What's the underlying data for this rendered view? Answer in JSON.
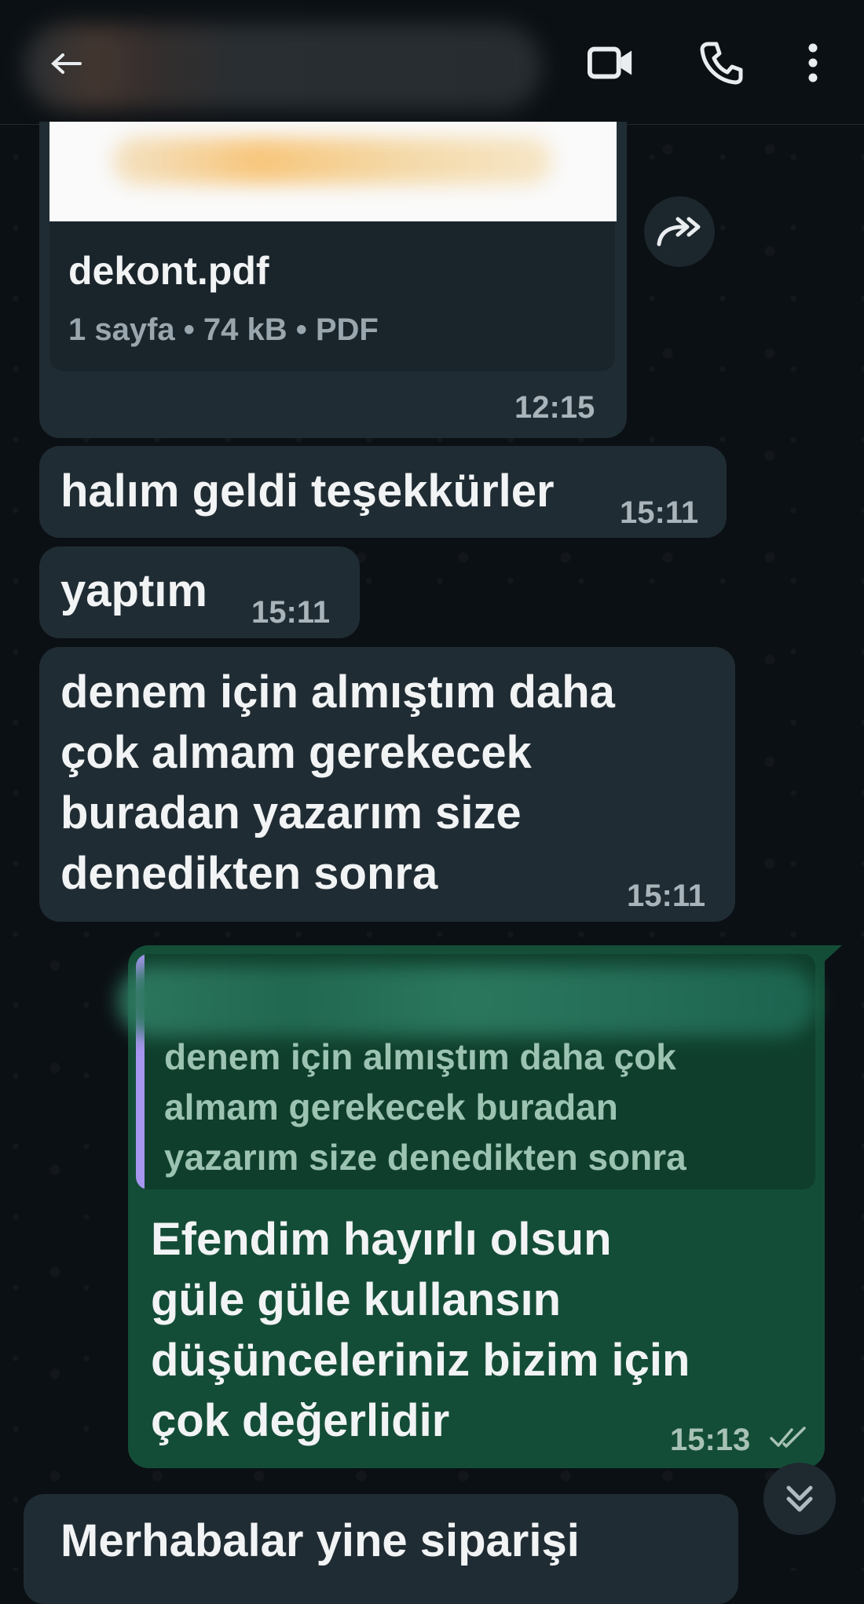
{
  "header": {
    "back_icon": "back-arrow-icon",
    "video_icon": "video-camera-icon",
    "call_icon": "phone-icon",
    "menu_icon": "more-vertical-icon"
  },
  "messages": [
    {
      "direction": "incoming",
      "type": "document",
      "file_name": "dekont.pdf",
      "file_meta": "1 sayfa • 74 kB • PDF",
      "time": "12:15"
    },
    {
      "direction": "incoming",
      "text": "halım geldi teşekkürler",
      "time": "15:11"
    },
    {
      "direction": "incoming",
      "text": "yaptım",
      "time": "15:11"
    },
    {
      "direction": "incoming",
      "lines": [
        "denem için almıştım daha",
        "çok almam gerekecek",
        "buradan yazarım size",
        "denedikten sonra"
      ],
      "time": "15:11"
    },
    {
      "direction": "outgoing",
      "quote_lines": [
        "denem için almıştım daha çok",
        "almam gerekecek buradan",
        "yazarım size denedikten sonra"
      ],
      "lines": [
        "Efendim hayırlı olsun",
        "güle güle kullansın",
        "düşünceleriniz bizim için",
        "çok değerlidir"
      ],
      "time": "15:13",
      "status": "read"
    },
    {
      "direction": "incoming",
      "text": "Merhabalar yine siparişi"
    }
  ],
  "colors": {
    "background": "#0b1014",
    "incoming_bubble": "#202c33",
    "outgoing_bubble": "#144d37",
    "quote_bar": "#a796f0",
    "read_tick": "#a7c2b5"
  }
}
